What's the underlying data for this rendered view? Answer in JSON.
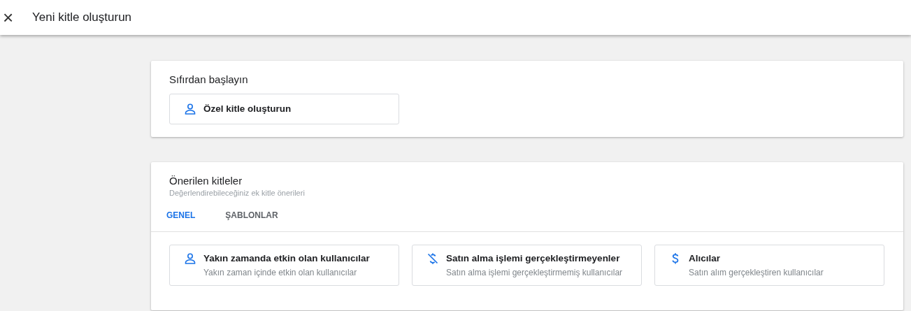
{
  "header": {
    "close": "×",
    "title": "Yeni kitle oluşturun"
  },
  "start_card": {
    "title": "Sıfırdan başlayın",
    "option": {
      "kind": "person",
      "label": "Özel kitle oluşturun"
    }
  },
  "suggested_card": {
    "title": "Önerilen kitleler",
    "subtitle": "Değerlendirebileceğiniz ek kitle önerileri",
    "tabs": [
      {
        "label": "GENEL",
        "selected": true
      },
      {
        "label": "ŞABLONLAR",
        "selected": false
      }
    ],
    "audiences": [
      {
        "kind": "person",
        "title": "Yakın zamanda etkin olan kullanıcılar",
        "description": "Yakın zaman içinde etkin olan kullanıcılar"
      },
      {
        "kind": "nopurchase",
        "title": "Satın alma işlemi gerçekleştirmeyenler",
        "description": "Satın alma işlemi gerçekleştirmemiş kullanıcılar"
      },
      {
        "kind": "purchase",
        "title": "Alıcılar",
        "description": "Satın alım gerçekleştiren kullanıcılar"
      }
    ]
  }
}
